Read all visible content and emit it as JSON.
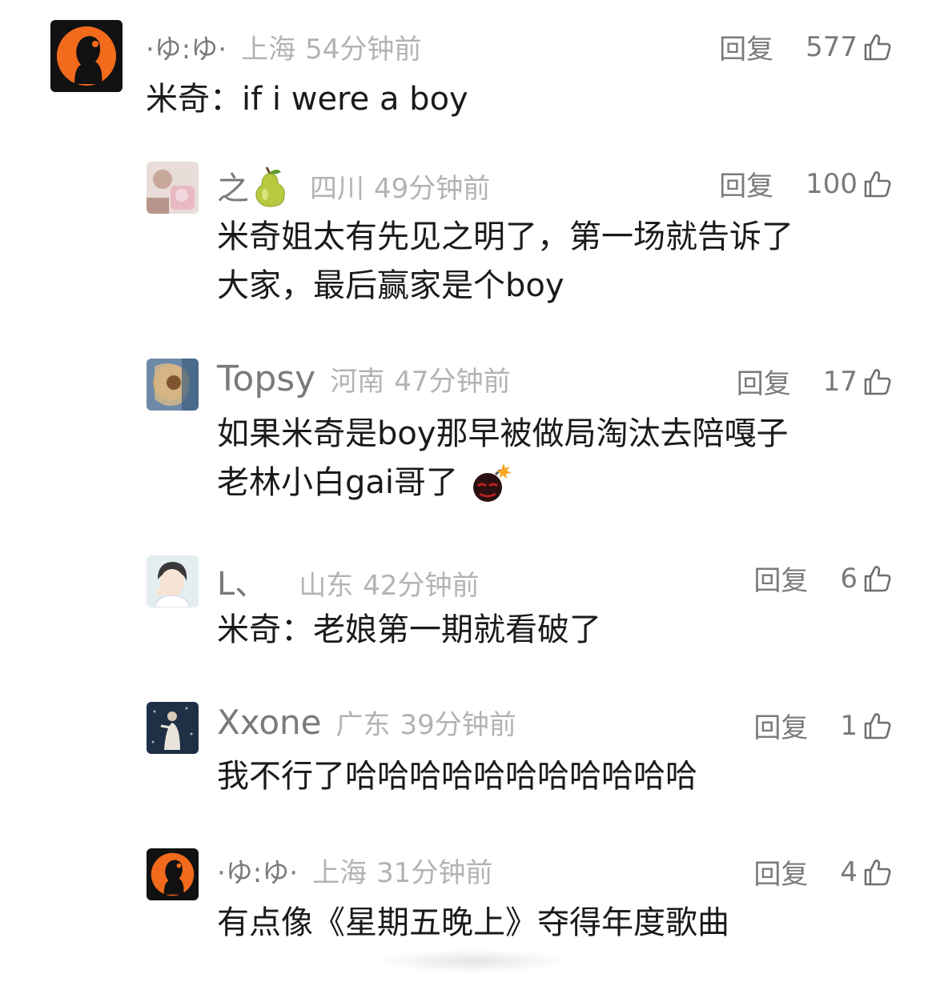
{
  "comments": [
    {
      "name": "·ゆ:ゆ·",
      "location": "上海",
      "time": "54分钟前",
      "reply": "回复",
      "likes": "577",
      "text": "米奇：if i were a boy",
      "avatar": "orange-silhouette-avatar"
    },
    {
      "name": "之",
      "name_emoji": "pear-emoji",
      "location": "四川",
      "time": "49分钟前",
      "reply": "回复",
      "likes": "100",
      "text_lines": [
        "米奇姐太有先见之明了，第一场就告诉了",
        "大家，最后赢家是个boy"
      ],
      "avatar": "photo-avatar-pink"
    },
    {
      "name": "Topsy",
      "location": "河南",
      "time": "47分钟前",
      "reply": "回复",
      "likes": "17",
      "text_lines": [
        "如果米奇是boy那早被做局淘汰去陪嘎子",
        "老林小白gai哥了"
      ],
      "text_emoji": "bomb-emoji",
      "avatar": "painting-avatar"
    },
    {
      "name": "L、",
      "location": "山东",
      "time": "42分钟前",
      "reply": "回复",
      "likes": "6",
      "text": "米奇：老娘第一期就看破了",
      "avatar": "illustrated-boy-avatar"
    },
    {
      "name": "Xxone",
      "location": "广东",
      "time": "39分钟前",
      "reply": "回复",
      "likes": "1",
      "text": "我不行了哈哈哈哈哈哈哈哈哈哈哈",
      "avatar": "dark-blue-photo-avatar"
    },
    {
      "name": "·ゆ:ゆ·",
      "location": "上海",
      "time": "31分钟前",
      "reply": "回复",
      "likes": "4",
      "text": "有点像《星期五晚上》夺得年度歌曲",
      "avatar": "orange-silhouette-avatar"
    }
  ],
  "colors": {
    "name": "#7a7a7a",
    "meta": "#b3b3b3",
    "text": "#1a1a1a",
    "avatar_orange": "#f26a1b"
  }
}
